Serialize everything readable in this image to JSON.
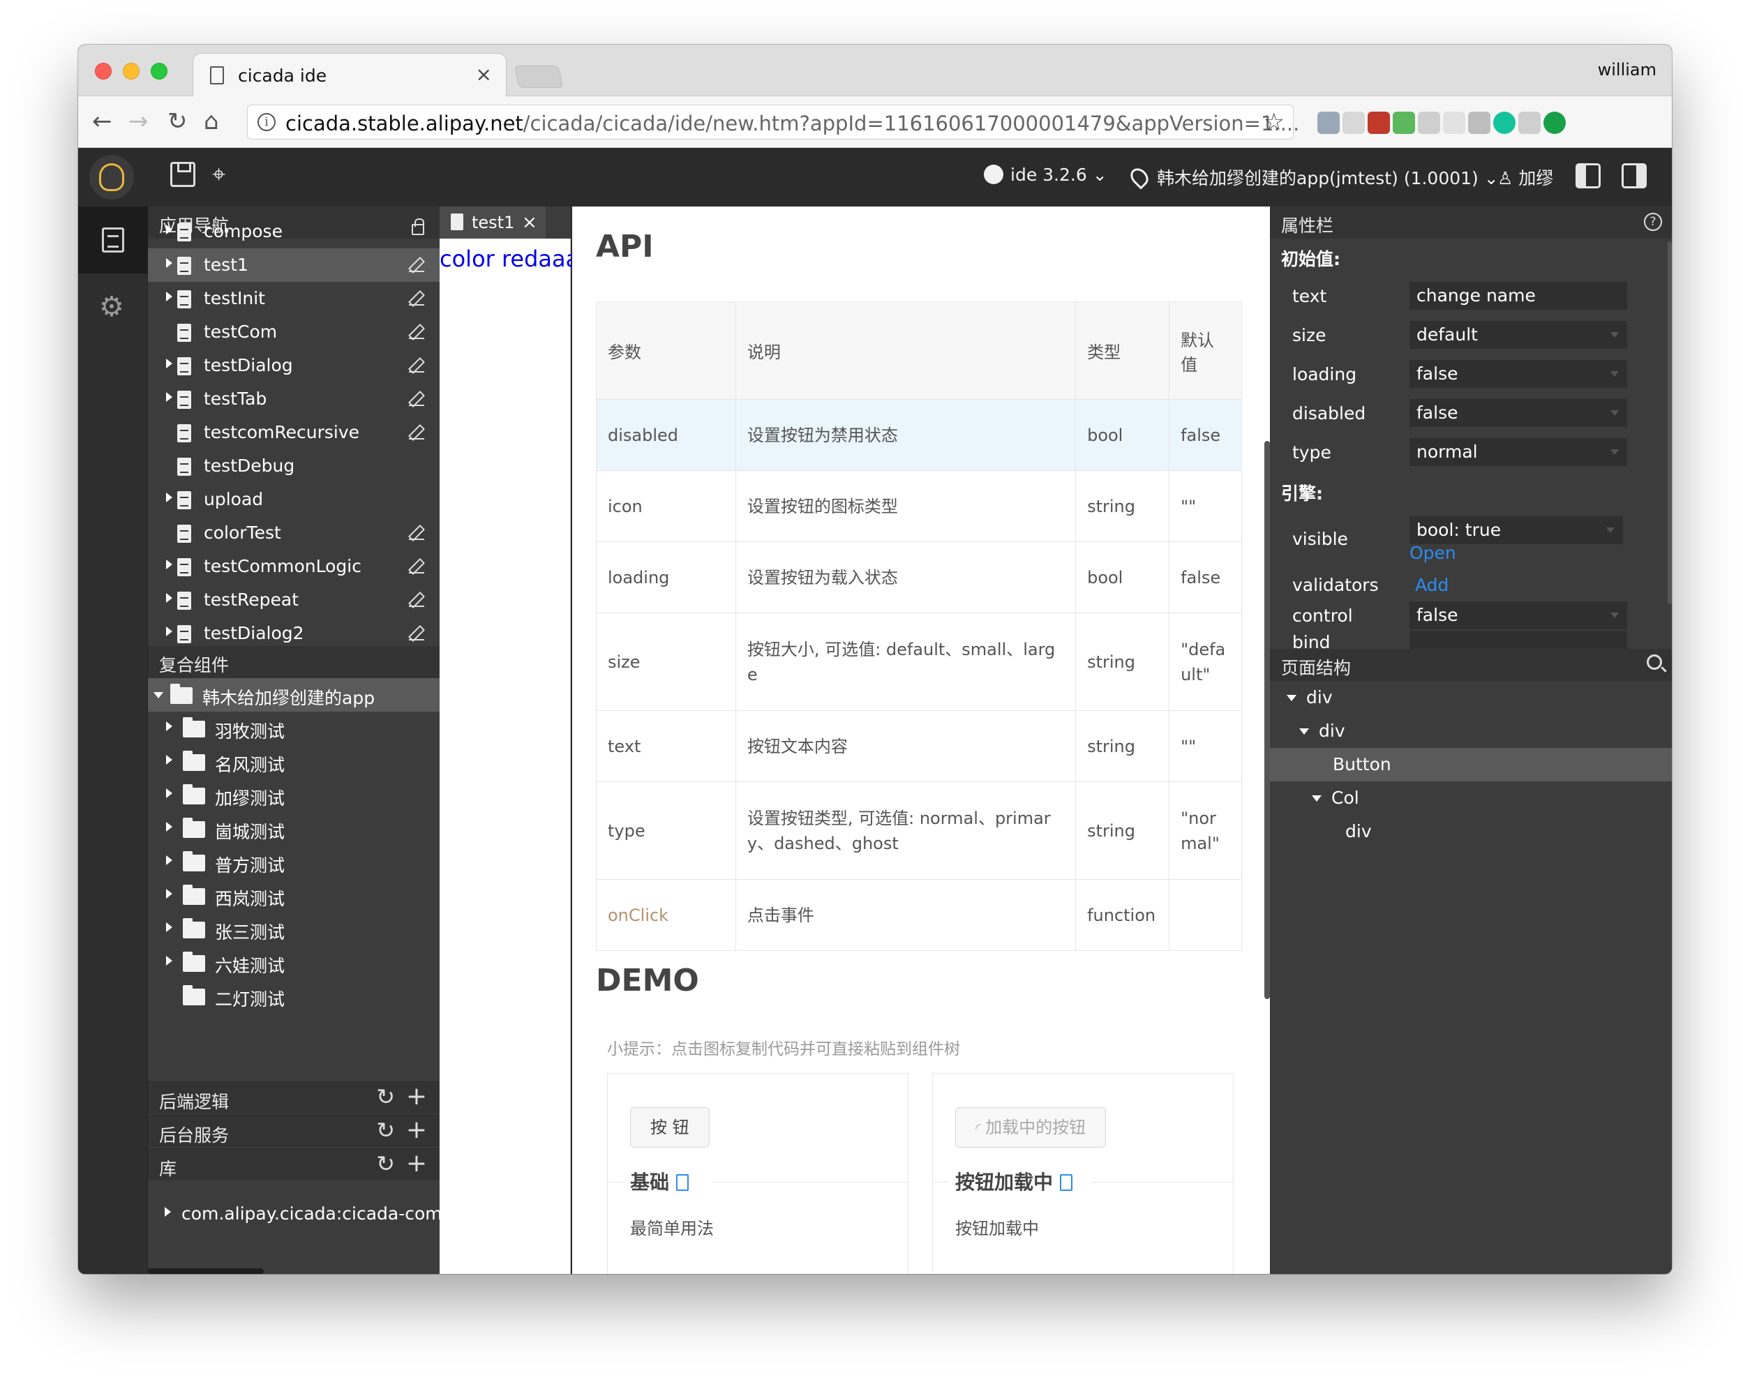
{
  "browser": {
    "tab_title": "cicada ide",
    "tab_close": "×",
    "profile_name": "william",
    "url_host": "cicada.stable.alipay.net",
    "url_path": "/cicada/cicada/ide/new.htm?appId=116160617000001479&appVersion=1....",
    "back_icon": "←",
    "forward_icon": "→",
    "reload_icon": "↻",
    "home_icon": "⌂",
    "bookmark_icon": "☆",
    "extensions": [
      {
        "name": "search-extension-icon",
        "color": "#9aa7b7"
      },
      {
        "name": "extension-icon-2",
        "color": "#d8d8d8"
      },
      {
        "name": "extension-icon-3",
        "color": "#c0392b"
      },
      {
        "name": "extension-icon-4",
        "color": "#5cb85c"
      },
      {
        "name": "extension-icon-5",
        "color": "#cfcfcf"
      },
      {
        "name": "extension-icon-6",
        "color": "#e2e2e2"
      },
      {
        "name": "extension-icon-7",
        "color": "#bdbdbd"
      },
      {
        "name": "grammarly-icon",
        "color": "#15c39a"
      },
      {
        "name": "extension-icon-9",
        "color": "#cfcfcf"
      },
      {
        "name": "update-icon",
        "color": "#1a9f49"
      }
    ]
  },
  "header": {
    "ide_version": "ide 3.2.6 ⌄",
    "app_name": "韩木给加缪创建的app(jmtest) (1.0001) ⌄",
    "user_name": "加缪",
    "tag_icon": "⌖"
  },
  "activity": {
    "gear_icon": "⚙"
  },
  "sidebar": {
    "nav_title": "应用导航",
    "pages": [
      {
        "label": "compose",
        "caret": true,
        "action": "lock"
      },
      {
        "label": "test1",
        "caret": true,
        "action": "edit",
        "selected": true
      },
      {
        "label": "testInit",
        "caret": true,
        "action": "edit"
      },
      {
        "label": "testCom",
        "caret": false,
        "action": "edit"
      },
      {
        "label": "testDialog",
        "caret": true,
        "action": "edit"
      },
      {
        "label": "testTab",
        "caret": true,
        "action": "edit"
      },
      {
        "label": "testcomRecursive",
        "caret": false,
        "action": "edit"
      },
      {
        "label": "testDebug",
        "caret": false,
        "action": "none"
      },
      {
        "label": "upload",
        "caret": true,
        "action": "none"
      },
      {
        "label": "colorTest",
        "caret": false,
        "action": "edit"
      },
      {
        "label": "testCommonLogic",
        "caret": true,
        "action": "edit"
      },
      {
        "label": "testRepeat",
        "caret": true,
        "action": "edit"
      },
      {
        "label": "testDialog2",
        "caret": true,
        "action": "edit"
      }
    ],
    "components_title": "复合组件",
    "app_folder": "韩木给加缪创建的app",
    "folders": [
      {
        "label": "羽牧测试",
        "caret": true
      },
      {
        "label": "名风测试",
        "caret": true
      },
      {
        "label": "加缪测试",
        "caret": true
      },
      {
        "label": "崮城测试",
        "caret": true
      },
      {
        "label": "普方测试",
        "caret": true
      },
      {
        "label": "西岚测试",
        "caret": true
      },
      {
        "label": "张三测试",
        "caret": true
      },
      {
        "label": "六娃测试",
        "caret": true
      },
      {
        "label": "二灯测试",
        "caret": false
      }
    ],
    "backend_logic": "后端逻辑",
    "backend_service": "后台服务",
    "library": "库",
    "library_item": "com.alipay.cicada:cicada-comm",
    "refresh_icon": "↻",
    "add_icon": "+"
  },
  "editor": {
    "tab_label": "test1",
    "tab_close": "×",
    "code_text": "color redaaa"
  },
  "doc": {
    "api_title": "API",
    "api_headers": [
      "参数",
      "说明",
      "类型",
      "默认值"
    ],
    "api_rows": [
      {
        "param": "disabled",
        "desc": "设置按钮为禁用状态",
        "type": "bool",
        "default": "false"
      },
      {
        "param": "icon",
        "desc": "设置按钮的图标类型",
        "type": "string",
        "default": "\"\""
      },
      {
        "param": "loading",
        "desc": "设置按钮为载入状态",
        "type": "bool",
        "default": "false"
      },
      {
        "param": "size",
        "desc": "按钮大小, 可选值: default、small、large",
        "type": "string",
        "default": "\"default\""
      },
      {
        "param": "text",
        "desc": "按钮文本内容",
        "type": "string",
        "default": "\"\""
      },
      {
        "param": "type",
        "desc": "设置按钮类型, 可选值: normal、primary、dashed、ghost",
        "type": "string",
        "default": "\"normal\""
      },
      {
        "param": "onClick",
        "desc": "点击事件",
        "type": "function",
        "default": ""
      }
    ],
    "demo_title": "DEMO",
    "hint": "小提示：点击图标复制代码并可直接粘贴到组件树",
    "cards": [
      {
        "button": "按 钮",
        "title": "基础",
        "desc": "最简单用法"
      },
      {
        "button": "加载中的按钮",
        "title": "按钮加载中",
        "desc": "按钮加载中"
      }
    ]
  },
  "props": {
    "title": "属性栏",
    "help_icon": "?",
    "initial_label": "初始值:",
    "initial": [
      {
        "key": "text",
        "value": "change name",
        "select": false
      },
      {
        "key": "size",
        "value": "default",
        "select": true
      },
      {
        "key": "loading",
        "value": "false",
        "select": true
      },
      {
        "key": "disabled",
        "value": "false",
        "select": true
      },
      {
        "key": "type",
        "value": "normal",
        "select": true
      }
    ],
    "engine_label": "引擎:",
    "visible_key": "visible",
    "visible_value": "bool: true",
    "visible_link": "Open",
    "validators_key": "validators",
    "validators_link": "Add",
    "control_key": "control",
    "control_value": "false",
    "bind_key": "bind",
    "bind_value": ""
  },
  "structure": {
    "title": "页面结构",
    "nodes": [
      {
        "label": "div",
        "caret": true
      },
      {
        "label": "div",
        "caret": true
      },
      {
        "label": "Button",
        "caret": false,
        "selected": true
      },
      {
        "label": "Col",
        "caret": true
      },
      {
        "label": "div",
        "caret": false
      }
    ]
  }
}
